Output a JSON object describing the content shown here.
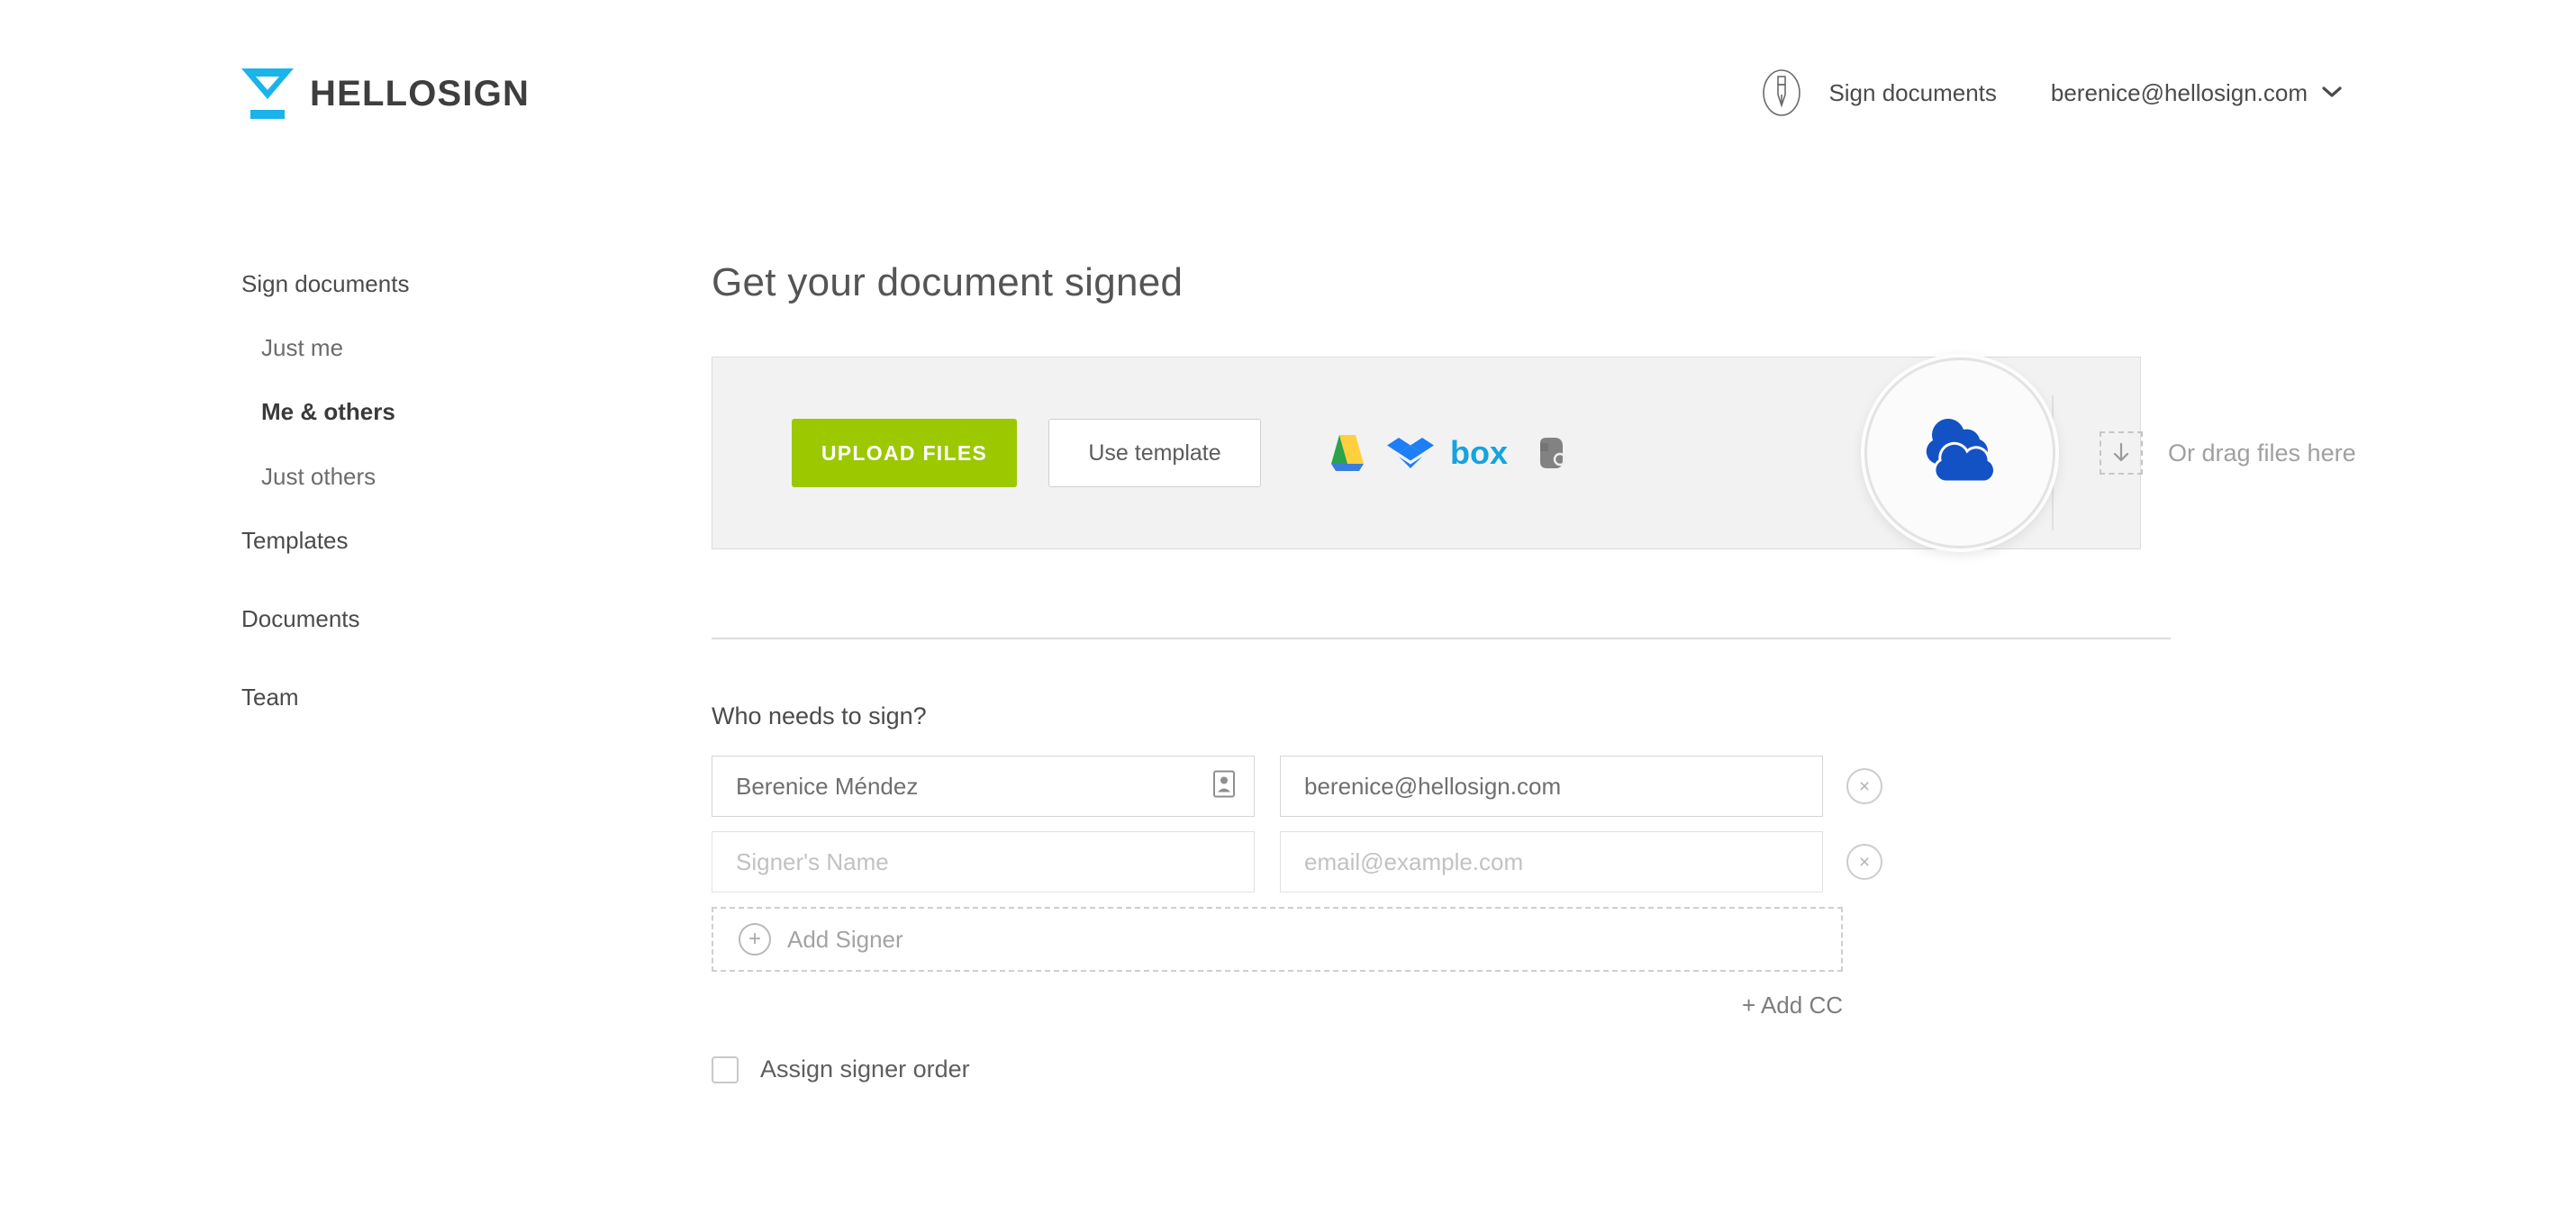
{
  "brand": {
    "logo_text": "HELLOSIGN",
    "logo_color": "#1ab3ea",
    "accent_green": "#9cc800"
  },
  "header": {
    "pen_icon": "pen-nib-icon",
    "sign_documents_label": "Sign documents",
    "account_email": "berenice@hellosign.com",
    "chevron": "⌄"
  },
  "sidebar": {
    "items": [
      {
        "label": "Sign documents",
        "level": "top",
        "active": false
      },
      {
        "label": "Just me",
        "level": "sub",
        "active": false
      },
      {
        "label": "Me & others",
        "level": "sub",
        "active": true
      },
      {
        "label": "Just others",
        "level": "sub",
        "active": false
      },
      {
        "label": "Templates",
        "level": "group",
        "active": false
      },
      {
        "label": "Documents",
        "level": "group",
        "active": false
      },
      {
        "label": "Team",
        "level": "group",
        "active": false
      }
    ]
  },
  "main": {
    "page_title": "Get your document signed",
    "upload": {
      "upload_button_label": "UPLOAD FILES",
      "use_template_label": "Use template",
      "drag_text": "Or drag files here",
      "drag_icon": "download-arrow-icon",
      "cloud_services": [
        {
          "name": "google-drive-icon",
          "label": "Google Drive"
        },
        {
          "name": "dropbox-icon",
          "label": "Dropbox"
        },
        {
          "name": "box-icon",
          "label": "Box"
        },
        {
          "name": "evernote-icon",
          "label": "Evernote"
        }
      ],
      "highlighted_service": {
        "name": "onedrive-icon",
        "label": "OneDrive",
        "color": "#1352c4"
      }
    },
    "signers": {
      "title": "Who needs to sign?",
      "rows": [
        {
          "name_value": "Berenice Méndez",
          "name_placeholder": "Signer's Name",
          "email_value": "berenice@hellosign.com",
          "email_placeholder": "email@example.com",
          "has_contacts_icon": true,
          "remove_label": "×"
        },
        {
          "name_value": "",
          "name_placeholder": "Signer's Name",
          "email_value": "",
          "email_placeholder": "email@example.com",
          "has_contacts_icon": false,
          "remove_label": "×"
        }
      ],
      "add_signer_label": "Add Signer",
      "add_signer_plus": "+",
      "add_cc_label": "+ Add CC",
      "assign_order_label": "Assign signer order",
      "assign_order_checked": false
    }
  }
}
